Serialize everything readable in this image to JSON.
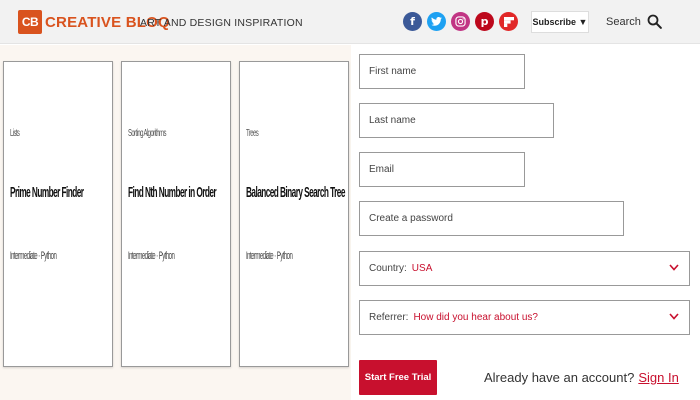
{
  "header": {
    "logo_badge": "CB",
    "logo_text": "CREATIVE BLOQ",
    "tagline": "ART AND DESIGN INSPIRATION",
    "socials": [
      {
        "name": "facebook",
        "glyph": "f",
        "color": "#3b5998"
      },
      {
        "name": "twitter",
        "glyph": "t",
        "color": "#1da1f2"
      },
      {
        "name": "instagram",
        "glyph": "◎",
        "color": "#c13584"
      },
      {
        "name": "pinterest",
        "glyph": "p",
        "color": "#bd081c"
      },
      {
        "name": "flipboard",
        "glyph": "f",
        "color": "#e12828"
      }
    ],
    "subscribe_label": "Subscribe ▼",
    "search_label": "Search"
  },
  "cards": [
    {
      "category": "Lists",
      "title": "Prime Number Finder",
      "meta": "Intermediate · Python"
    },
    {
      "category": "Sorting Algorithms",
      "title": "Find Nth Number in Order",
      "meta": "Intermediate · Python"
    },
    {
      "category": "Trees",
      "title": "Balanced Binary Search Tree",
      "meta": "Intermediate · Python"
    }
  ],
  "form": {
    "first_name_placeholder": "First name",
    "last_name_placeholder": "Last name",
    "email_placeholder": "Email",
    "password_placeholder": "Create a password",
    "country_label": "Country:",
    "country_value": "USA",
    "referrer_label": "Referrer:",
    "referrer_value": "How did you hear about us?",
    "cta_label": "Start Free Trial",
    "account_prompt": "Already have an account?",
    "signin_label": "Sign In"
  },
  "colors": {
    "brand": "#d9531e",
    "accent": "#c8102e"
  }
}
